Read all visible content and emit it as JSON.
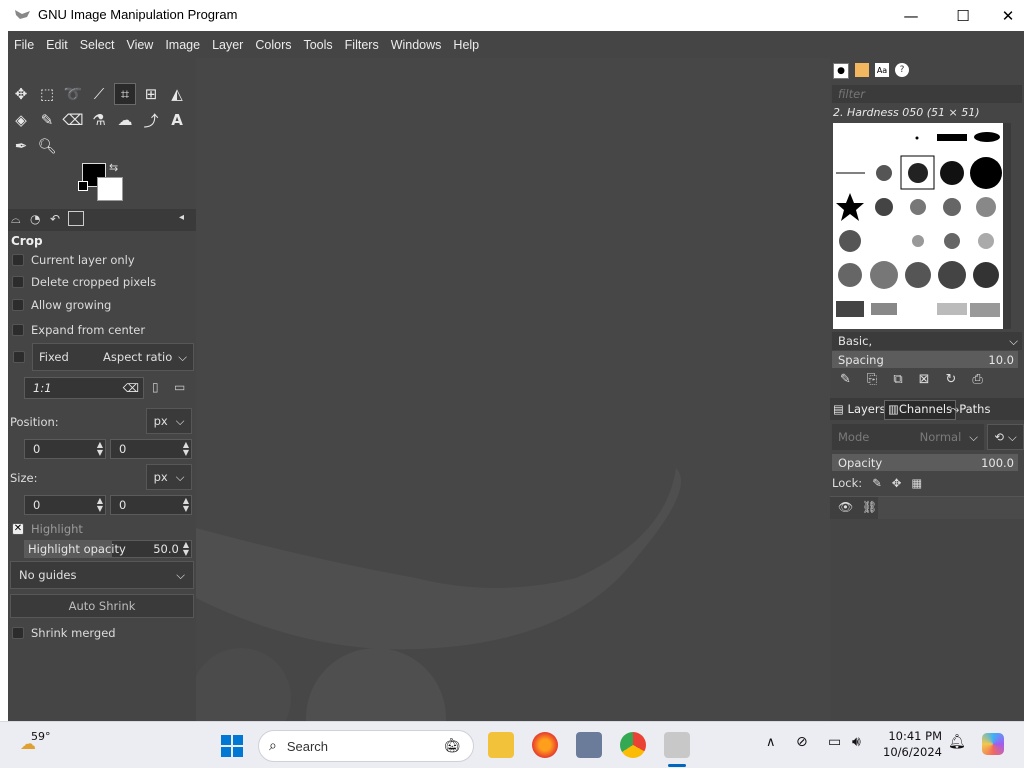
{
  "window": {
    "title": "GNU Image Manipulation Program",
    "minimize": "—",
    "maximize": "☐",
    "close": "✕"
  },
  "menu": [
    "File",
    "Edit",
    "Select",
    "View",
    "Image",
    "Layer",
    "Colors",
    "Tools",
    "Filters",
    "Windows",
    "Help"
  ],
  "tool_options": {
    "title": "Crop",
    "options": [
      "Current layer only",
      "Delete cropped pixels",
      "Allow growing",
      "Expand from center"
    ],
    "fixed_label": "Fixed",
    "fixed_mode": "Aspect ratio",
    "ratio_value": "1:1",
    "position_label": "Position:",
    "size_label": "Size:",
    "unit": "px",
    "pos_x": "0",
    "pos_y": "0",
    "size_x": "0",
    "size_y": "0",
    "highlight_label": "Highlight",
    "highlight_opacity_label": "Highlight opacity",
    "highlight_opacity_value": "50.0",
    "guides": "No guides",
    "auto_shrink": "Auto Shrink",
    "shrink_merged": "Shrink merged"
  },
  "brushes": {
    "filter_placeholder": "filter",
    "selected": "2. Hardness 050 (51 × 51)",
    "preset": "Basic,",
    "spacing_label": "Spacing",
    "spacing_value": "10.0"
  },
  "layers": {
    "tabs": [
      "Layers",
      "Channels",
      "Paths"
    ],
    "mode_label": "Mode",
    "mode_value": "Normal",
    "opacity_label": "Opacity",
    "opacity_value": "100.0",
    "lock_label": "Lock:"
  },
  "taskbar": {
    "temperature": "59°",
    "search": "Search",
    "time": "10:41 PM",
    "date": "10/6/2024"
  },
  "colors": {
    "accent": "#0067c0",
    "bg": "#454545",
    "canvas": "#474747"
  }
}
